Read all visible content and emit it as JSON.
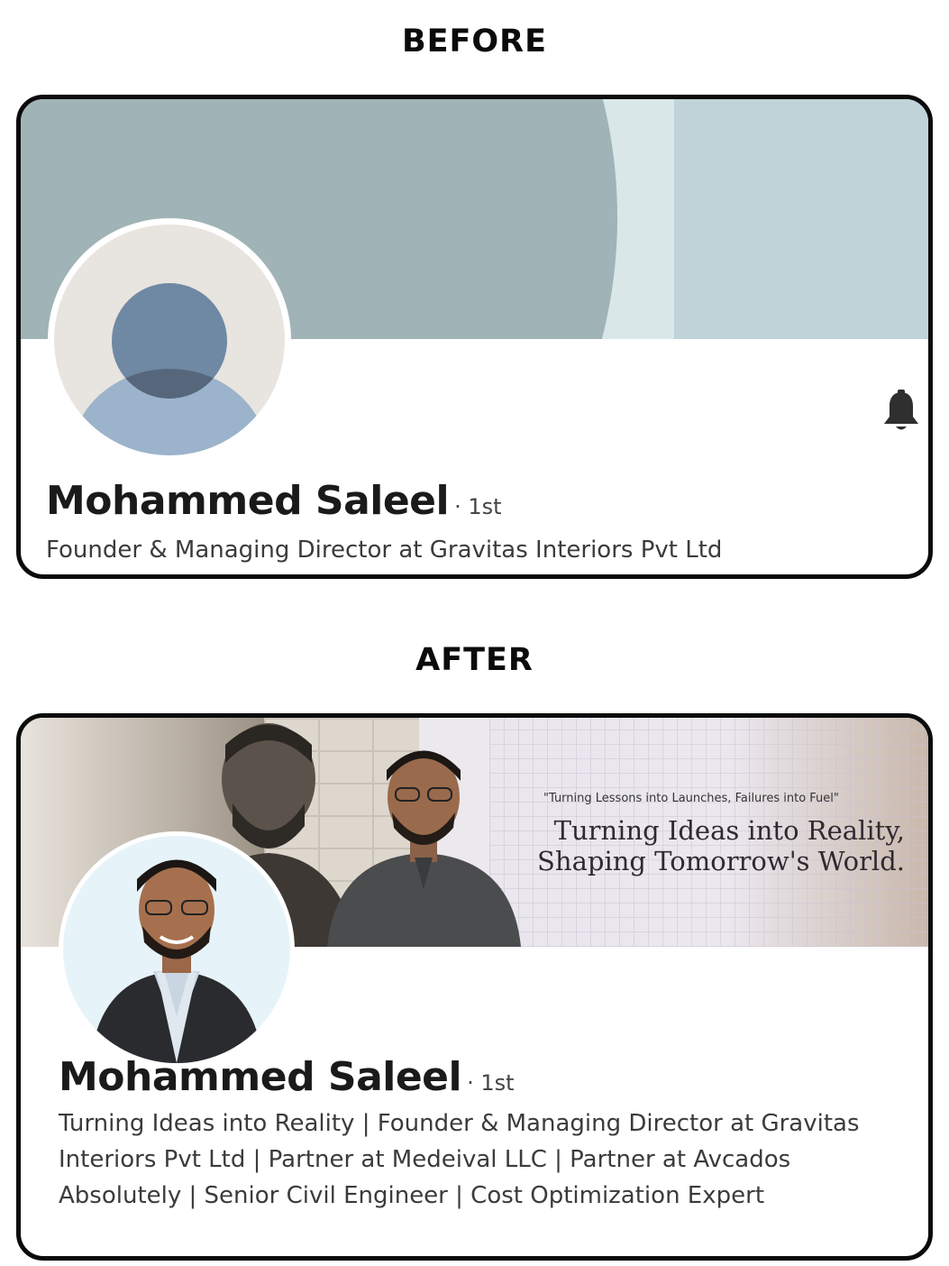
{
  "before": {
    "heading": "BEFORE",
    "name": "Mohammed Saleel",
    "degree": "· 1st",
    "headline": "Founder & Managing Director at Gravitas Interiors Pvt Ltd",
    "icons": [
      "default-avatar-icon",
      "bell-icon"
    ]
  },
  "after": {
    "heading": "AFTER",
    "banner_quote": "\"Turning Lessons into Launches, Failures into Fuel\"",
    "banner_tagline_line1": "Turning Ideas into Reality,",
    "banner_tagline_line2": "Shaping Tomorrow's World.",
    "name": "Mohammed Saleel",
    "degree": "· 1st",
    "headline": "Turning Ideas into Reality | Founder & Managing Director at Gravitas Interiors Pvt Ltd | Partner at Medeival LLC | Partner at Avcados Absolutely | Senior Civil Engineer | Cost Optimization Expert"
  },
  "colors": {
    "border": "#0b0b0b",
    "before_banner": "#a0b3b6",
    "before_banner_light": "#bfd3d8",
    "avatar_bg": "#e8e4df",
    "avatar_figure": "#6f89a4"
  }
}
